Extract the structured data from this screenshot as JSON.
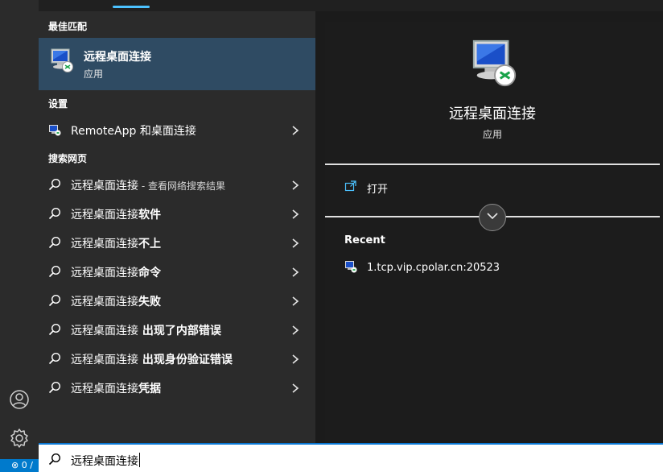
{
  "status": {
    "text": "⊗ 0 /"
  },
  "best_match": {
    "header": "最佳匹配",
    "title": "远程桌面连接",
    "subtitle": "应用",
    "icon": "remote-desktop-icon"
  },
  "settings": {
    "header": "设置",
    "items": [
      {
        "label": "RemoteApp 和桌面连接",
        "icon": "remoteapp-icon"
      }
    ]
  },
  "web": {
    "header": "搜索网页",
    "first": {
      "prefix": "远程桌面连接",
      "suffix": " - 查看网络搜索结果"
    },
    "items": [
      {
        "prefix": "远程桌面连接",
        "bold": "软件"
      },
      {
        "prefix": "远程桌面连接",
        "bold": "不上"
      },
      {
        "prefix": "远程桌面连接",
        "bold": "命令"
      },
      {
        "prefix": "远程桌面连接",
        "bold": "失败"
      },
      {
        "prefix": "远程桌面连接",
        "bold": " 出现了内部错误"
      },
      {
        "prefix": "远程桌面连接",
        "bold": " 出现身份验证错误"
      },
      {
        "prefix": "远程桌面连接",
        "bold": "凭据"
      }
    ]
  },
  "detail": {
    "app_name": "远程桌面连接",
    "app_type": "应用",
    "open_label": "打开",
    "recent_header": "Recent",
    "recent": [
      {
        "label": "1.tcp.vip.cpolar.cn:20523"
      }
    ]
  },
  "search": {
    "value": "远程桌面连接"
  },
  "colors": {
    "accent": "#0a78d4",
    "selection": "#2f4b63",
    "pill": "#4cc2ff"
  }
}
